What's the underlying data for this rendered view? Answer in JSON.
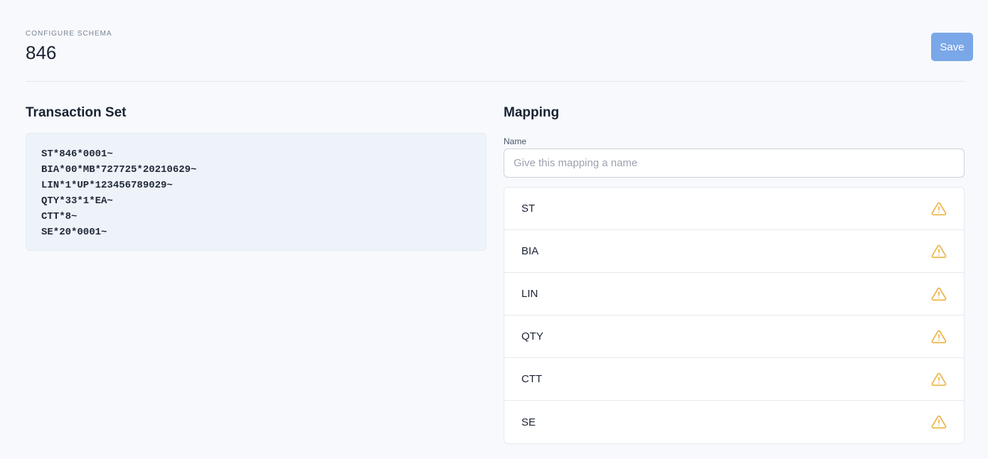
{
  "header": {
    "eyebrow": "CONFIGURE SCHEMA",
    "title": "846",
    "save_label": "Save"
  },
  "transaction": {
    "title": "Transaction Set",
    "lines": [
      "ST*846*0001~",
      "BIA*00*MB*727725*20210629~",
      "LIN*1*UP*123456789029~",
      "QTY*33*1*EA~",
      "CTT*8~",
      "SE*20*0001~"
    ]
  },
  "mapping": {
    "title": "Mapping",
    "name_label": "Name",
    "name_value": "",
    "name_placeholder": "Give this mapping a name",
    "segments": [
      {
        "label": "ST",
        "icon": "warning-icon"
      },
      {
        "label": "BIA",
        "icon": "warning-icon"
      },
      {
        "label": "LIN",
        "icon": "warning-icon"
      },
      {
        "label": "QTY",
        "icon": "warning-icon"
      },
      {
        "label": "CTT",
        "icon": "warning-icon"
      },
      {
        "label": "SE",
        "icon": "warning-icon"
      }
    ]
  },
  "colors": {
    "primary_button": "#7aa7e8",
    "warning": "#eab64a",
    "code_background": "#eef2f9"
  }
}
